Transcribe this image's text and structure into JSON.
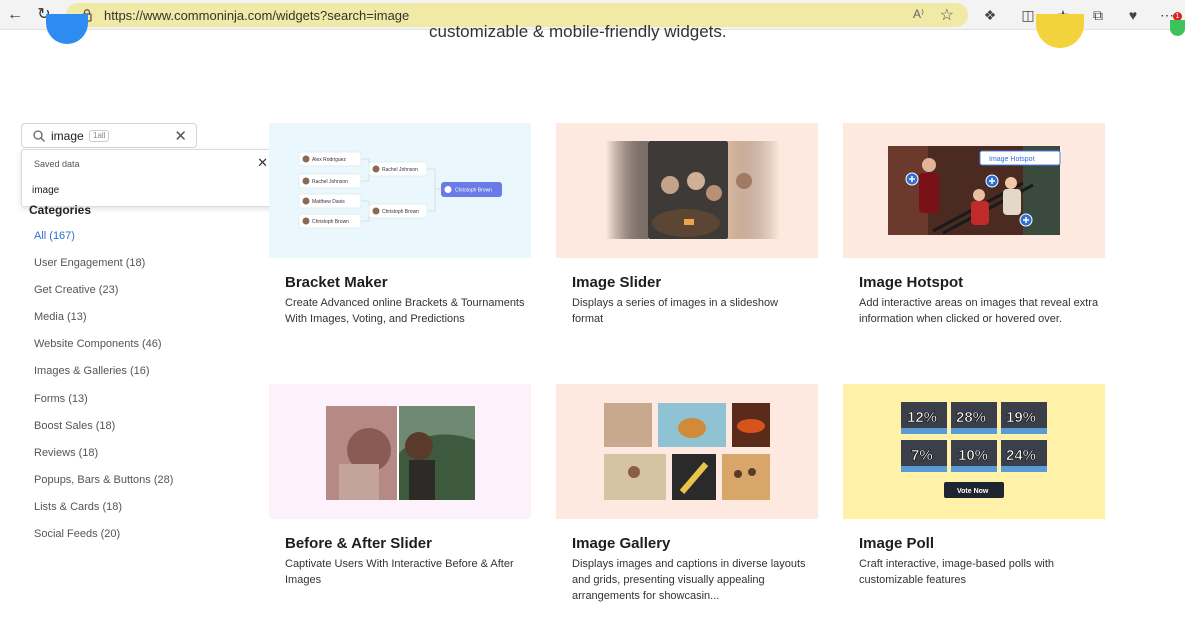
{
  "browser": {
    "url": "https://www.commoninja.com/widgets?search=image",
    "notification_count": "1"
  },
  "hero": {
    "subtitle_partial": "customizable & mobile-friendly widgets."
  },
  "search": {
    "value": "image",
    "tag": "1all",
    "dropdown_header": "Saved data",
    "dropdown_item": "image"
  },
  "categories": {
    "title": "Categories",
    "items": [
      "All (167)",
      "User Engagement (18)",
      "Get Creative (23)",
      "Media (13)",
      "Website Components (46)",
      "Images & Galleries (16)",
      "Forms (13)",
      "Boost Sales (18)",
      "Reviews (18)",
      "Popups, Bars & Buttons (28)",
      "Lists & Cards (18)",
      "Social Feeds (20)"
    ]
  },
  "colors": {
    "active_link": "#2d6fd6",
    "bracket_bg": "#eaf7fc",
    "peach_bg": "#fde9df",
    "lavender_bg": "#fdf2fb",
    "yellow_bg": "#fff2a8",
    "accent_blue": "#6a7be8"
  },
  "widgets": [
    {
      "title": "Bracket Maker",
      "description": "Create Advanced online Brackets & Tournaments With Images, Voting, and Predictions",
      "thumb": {
        "left": [
          "Alex Rodriguez",
          "Rachel Johnson",
          "Matthew Davis",
          "Christoph Brown"
        ],
        "middle": [
          "Rachel Johnson",
          "Christoph Brown"
        ],
        "winner": "Christoph Brown"
      }
    },
    {
      "title": "Image Slider",
      "description": "Displays a series of images in a slideshow format"
    },
    {
      "title": "Image Hotspot",
      "description": "Add interactive areas on images that reveal extra information when clicked or hovered over.",
      "thumb": {
        "label": "Image Hotspot"
      }
    },
    {
      "title": "Before & After Slider",
      "description": "Captivate Users With Interactive Before & After Images"
    },
    {
      "title": "Image Gallery",
      "description": "Displays images and captions in diverse layouts and grids, presenting visually appealing arrangements for showcasin..."
    },
    {
      "title": "Image Poll",
      "description": "Craft interactive, image-based polls with customizable features",
      "thumb": {
        "percents": [
          "12%",
          "28%",
          "19%",
          "7%",
          "10%",
          "24%"
        ],
        "button": "Vote Now"
      }
    }
  ]
}
